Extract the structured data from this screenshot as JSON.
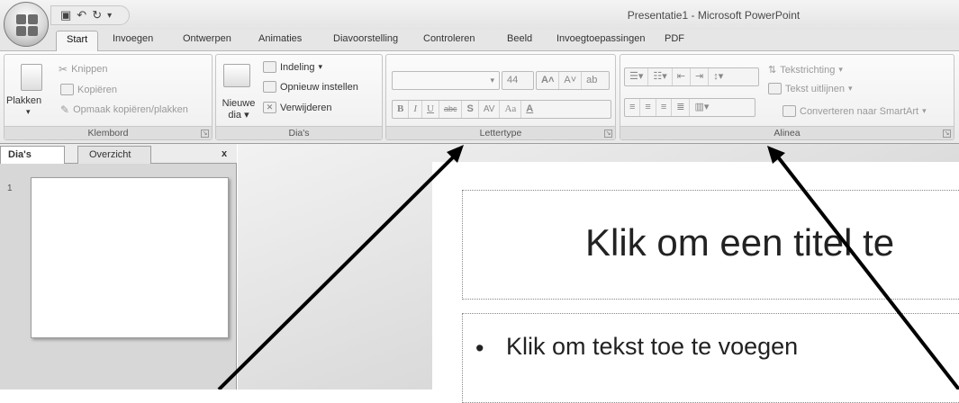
{
  "app": {
    "window_title": "Presentatie1 - Microsoft PowerPoint"
  },
  "tabs": [
    "Start",
    "Invoegen",
    "Ontwerpen",
    "Animaties",
    "Diavoorstelling",
    "Controleren",
    "Beeld",
    "Invoegtoepassingen",
    "PDF"
  ],
  "active_tab": "Start",
  "ribbon": {
    "klembord": {
      "label": "Klembord",
      "paste": "Plakken",
      "cut": "Knippen",
      "copy": "Kopiëren",
      "format_painter": "Opmaak kopiëren/plakken"
    },
    "dias": {
      "label": "Dia's",
      "new_slide_1": "Nieuwe",
      "new_slide_2": "dia",
      "layout": "Indeling",
      "reset": "Opnieuw instellen",
      "delete": "Verwijderen"
    },
    "lettertype": {
      "label": "Lettertype",
      "font_size": "44",
      "bold": "B",
      "italic": "I",
      "underline": "U",
      "strike": "abc",
      "shadow": "S",
      "spacing": "AV",
      "case": "Aa"
    },
    "alinea": {
      "label": "Alinea",
      "text_direction": "Tekstrichting",
      "align_text": "Tekst uitlijnen",
      "smartart": "Converteren naar SmartArt"
    }
  },
  "left_pane": {
    "tab_slides": "Dia's",
    "tab_outline": "Overzicht",
    "close": "x",
    "slide_number": "1"
  },
  "slide": {
    "title": "Klik om een titel te",
    "bullet": "Klik om tekst toe te voegen",
    "bullet_marker": "•"
  },
  "colors": {
    "ribbon_bg": "#efefef",
    "arrow": "#000000"
  }
}
